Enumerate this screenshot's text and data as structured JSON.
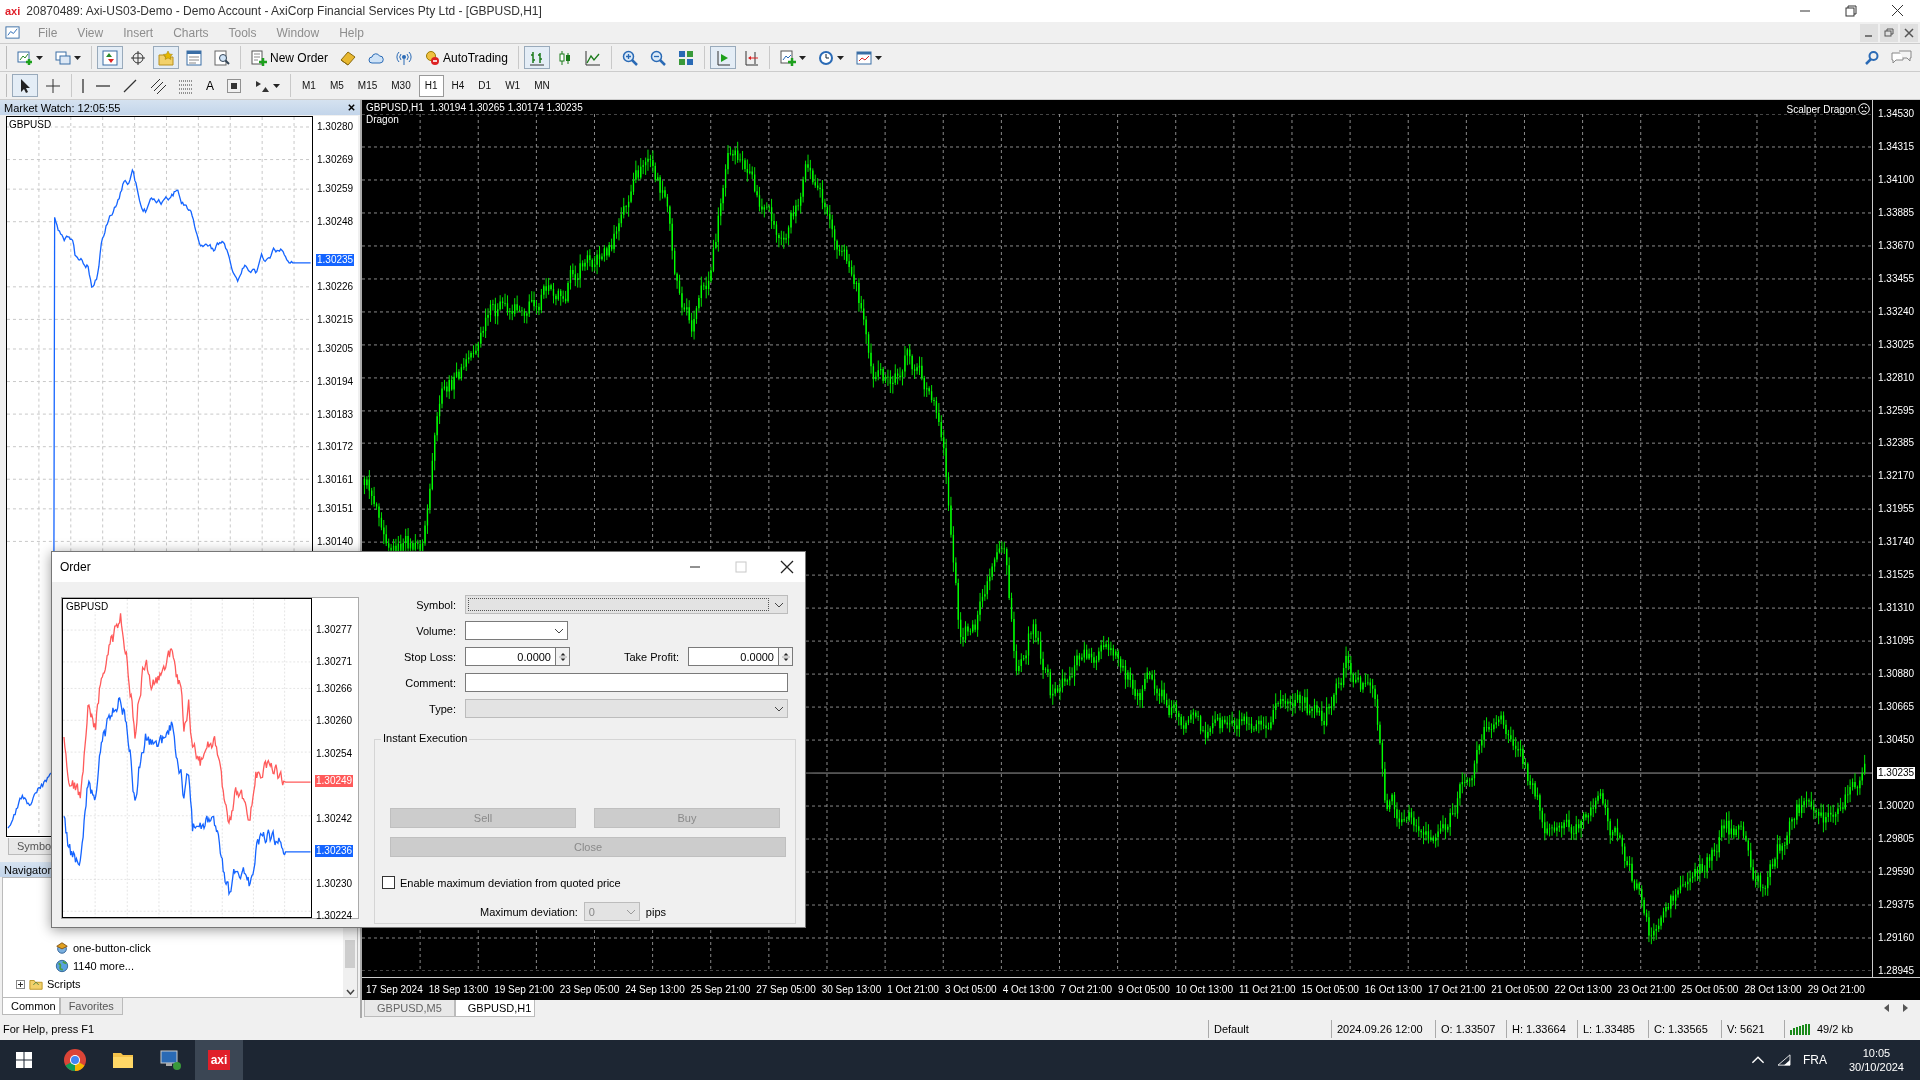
{
  "window": {
    "app_logo": "axi",
    "title": "20870489: Axi-US03-Demo - Demo Account - AxiCorp Financial Services Pty Ltd - [GBPUSD,H1]"
  },
  "menu": [
    {
      "label": "File",
      "disabled": true
    },
    {
      "label": "View",
      "disabled": true
    },
    {
      "label": "Insert",
      "disabled": true
    },
    {
      "label": "Charts",
      "disabled": true
    },
    {
      "label": "Tools",
      "disabled": true
    },
    {
      "label": "Window",
      "disabled": true
    },
    {
      "label": "Help",
      "disabled": true
    }
  ],
  "toolbars": [
    {
      "groups": [
        {
          "items": [
            {
              "kind": "new-chart",
              "pressed": false
            },
            {
              "kind": "profiles",
              "pressed": false
            }
          ]
        },
        {
          "items": [
            {
              "kind": "market-watch",
              "pressed": true
            },
            {
              "kind": "data-window",
              "pressed": false
            },
            {
              "kind": "navigator",
              "pressed": true
            },
            {
              "kind": "terminal",
              "pressed": false
            },
            {
              "kind": "tester",
              "pressed": false
            }
          ]
        },
        {
          "items": [
            {
              "kind": "new-order",
              "label": "New Order",
              "pressed": false
            },
            {
              "kind": "metaeditor",
              "pressed": false
            },
            {
              "kind": "community",
              "pressed": false
            },
            {
              "kind": "signals",
              "pressed": false
            },
            {
              "kind": "autotrading",
              "label": "AutoTrading",
              "pressed": false
            }
          ]
        },
        {
          "items": [
            {
              "kind": "bar-chart",
              "pressed": true
            },
            {
              "kind": "candles",
              "pressed": false
            },
            {
              "kind": "line-chart",
              "pressed": false
            }
          ]
        },
        {
          "items": [
            {
              "kind": "zoom-in",
              "pressed": false
            },
            {
              "kind": "zoom-out",
              "pressed": false
            },
            {
              "kind": "tile",
              "pressed": false
            }
          ]
        },
        {
          "items": [
            {
              "kind": "autoscroll",
              "pressed": true
            },
            {
              "kind": "chart-shift",
              "pressed": false
            }
          ]
        },
        {
          "items": [
            {
              "kind": "indicators",
              "pressed": false
            },
            {
              "kind": "periods",
              "pressed": false
            },
            {
              "kind": "templates",
              "pressed": false
            }
          ]
        }
      ]
    },
    {
      "groups": [
        {
          "items": [
            {
              "kind": "cursor",
              "pressed": true
            },
            {
              "kind": "crosshair",
              "pressed": false
            }
          ]
        },
        {
          "items": [
            {
              "kind": "vline",
              "pressed": false
            },
            {
              "kind": "hline",
              "pressed": false
            },
            {
              "kind": "trendline",
              "pressed": false
            },
            {
              "kind": "channel",
              "pressed": false
            },
            {
              "kind": "fibo",
              "pressed": false
            },
            {
              "kind": "text",
              "glyph": "A",
              "pressed": false
            },
            {
              "kind": "label",
              "pressed": false
            },
            {
              "kind": "arrows",
              "pressed": false
            }
          ]
        }
      ],
      "periods": [
        {
          "label": "M1",
          "selected": false
        },
        {
          "label": "M5",
          "selected": false
        },
        {
          "label": "M15",
          "selected": false
        },
        {
          "label": "M30",
          "selected": false
        },
        {
          "label": "H1",
          "selected": true
        },
        {
          "label": "H4",
          "selected": false
        },
        {
          "label": "D1",
          "selected": false
        },
        {
          "label": "W1",
          "selected": false
        },
        {
          "label": "MN",
          "selected": false
        }
      ]
    }
  ],
  "market_watch": {
    "title": "Market Watch: 12:05:55",
    "symbol": "GBPUSD",
    "price_ticks": [
      "1.30280",
      "1.30269",
      "1.30259",
      "1.30248",
      "1.30226",
      "1.30215",
      "1.30205",
      "1.30194",
      "1.30183",
      "1.30172",
      "1.30161",
      "1.30151",
      "1.30140"
    ],
    "current_price": "1.30235",
    "tabs": [
      {
        "label": "Symbo",
        "selected": false
      }
    ]
  },
  "navigator": {
    "title": "Navigator",
    "items": [
      {
        "kind": "expert",
        "label": "one-button-click"
      },
      {
        "kind": "more",
        "label": "1140 more..."
      },
      {
        "kind": "folder",
        "label": "Scripts",
        "expanded": false
      }
    ],
    "tabs": [
      {
        "label": "Common",
        "selected": true
      },
      {
        "label": "Favorites",
        "selected": false
      }
    ]
  },
  "chart": {
    "symbol": "GBPUSD,H1",
    "ohlc": "1.30194 1.30265 1.30174 1.30235",
    "indicator": "Dragon",
    "expert": "Scalper Dragon",
    "price_ticks": [
      "1.34530",
      "1.34315",
      "1.34100",
      "1.33885",
      "1.33670",
      "1.33455",
      "1.33240",
      "1.33025",
      "1.32810",
      "1.32595",
      "1.32385",
      "1.32170",
      "1.31955",
      "1.31740",
      "1.31525",
      "1.31310",
      "1.31095",
      "1.30880",
      "1.30665",
      "1.30450",
      "1.30020",
      "1.29805",
      "1.29590",
      "1.29375",
      "1.29160",
      "1.28945"
    ],
    "current_price": "1.30235",
    "time_ticks": [
      "17 Sep 2024",
      "18 Sep 13:00",
      "19 Sep 21:00",
      "23 Sep 05:00",
      "24 Sep 13:00",
      "25 Sep 21:00",
      "27 Sep 05:00",
      "30 Sep 13:00",
      "1 Oct 21:00",
      "3 Oct 05:00",
      "4 Oct 13:00",
      "7 Oct 21:00",
      "9 Oct 05:00",
      "10 Oct 13:00",
      "11 Oct 21:00",
      "15 Oct 05:00",
      "16 Oct 13:00",
      "17 Oct 21:00",
      "21 Oct 05:00",
      "22 Oct 13:00",
      "23 Oct 21:00",
      "25 Oct 05:00",
      "28 Oct 13:00",
      "29 Oct 21:00"
    ]
  },
  "chart_tabs": [
    {
      "label": "GBPUSD,M5",
      "selected": false
    },
    {
      "label": "GBPUSD,H1",
      "selected": true
    }
  ],
  "order_dialog": {
    "title": "Order",
    "chart": {
      "symbol": "GBPUSD",
      "price_ticks": [
        "1.30277",
        "1.30271",
        "1.30266",
        "1.30260",
        "1.30254",
        "1.30242",
        "1.30230",
        "1.30224"
      ],
      "ask": "1.30249",
      "bid": "1.30236"
    },
    "symbol": {
      "label": "Symbol:",
      "disabled": true
    },
    "volume": {
      "label": "Volume:"
    },
    "stop_loss": {
      "label": "Stop Loss:",
      "value": "0.0000"
    },
    "take_profit": {
      "label": "Take Profit:",
      "value": "0.0000"
    },
    "comment": {
      "label": "Comment:"
    },
    "type": {
      "label": "Type:",
      "disabled": true
    },
    "group": "Instant Execution",
    "buttons": [
      {
        "label": "Sell",
        "disabled": true
      },
      {
        "label": "Buy",
        "disabled": true
      },
      {
        "label": "Close",
        "disabled": true
      }
    ],
    "deviation_check": {
      "label": "Enable maximum deviation from quoted price",
      "checked": false
    },
    "deviation": {
      "label": "Maximum deviation:",
      "value": "0",
      "unit": "pips",
      "disabled": true
    }
  },
  "status_bar": {
    "help": "For Help, press F1",
    "cells": [
      "Default",
      "2024.09.26 12:00",
      "O: 1.33507",
      "H: 1.33664",
      "L: 1.33485",
      "C: 1.33565",
      "V: 5621"
    ],
    "traffic": "49/2 kb"
  },
  "taskbar": {
    "apps": [
      {
        "kind": "browser",
        "active": false
      },
      {
        "kind": "folder",
        "active": false
      },
      {
        "kind": "computer",
        "active": false
      },
      {
        "kind": "axi",
        "label": "axi",
        "active": true
      }
    ],
    "language": "FRA",
    "time": "10:05",
    "date": "30/10/2024"
  }
}
